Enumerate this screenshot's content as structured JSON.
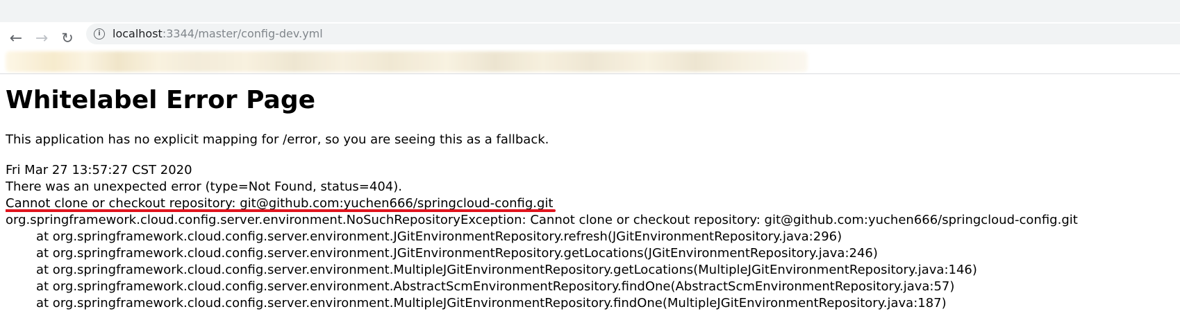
{
  "browser": {
    "url_host": "localhost",
    "url_path": ":3344/master/config-dev.yml",
    "back_icon": "arrow-left-icon",
    "forward_icon": "arrow-right-icon",
    "reload_icon": "reload-icon",
    "info_icon": "info-icon"
  },
  "page": {
    "title": "Whitelabel Error Page",
    "fallback_message": "This application has no explicit mapping for /error, so you are seeing this as a fallback.",
    "timestamp": "Fri Mar 27 13:57:27 CST 2020",
    "error_summary": "There was an unexpected error (type=Not Found, status=404).",
    "error_detail": "Cannot clone or checkout repository: git@github.com:yuchen666/springcloud-config.git",
    "exception": "org.springframework.cloud.config.server.environment.NoSuchRepositoryException: Cannot clone or checkout repository: git@github.com:yuchen666/springcloud-config.git",
    "stack_trace": [
      "at org.springframework.cloud.config.server.environment.JGitEnvironmentRepository.refresh(JGitEnvironmentRepository.java:296)",
      "at org.springframework.cloud.config.server.environment.JGitEnvironmentRepository.getLocations(JGitEnvironmentRepository.java:246)",
      "at org.springframework.cloud.config.server.environment.MultipleJGitEnvironmentRepository.getLocations(MultipleJGitEnvironmentRepository.java:146)",
      "at org.springframework.cloud.config.server.environment.AbstractScmEnvironmentRepository.findOne(AbstractScmEnvironmentRepository.java:57)",
      "at org.springframework.cloud.config.server.environment.MultipleJGitEnvironmentRepository.findOne(MultipleJGitEnvironmentRepository.java:187)"
    ]
  },
  "colors": {
    "underline": "#e0141e",
    "toolbar_icon": "#5f6368",
    "url_path": "#80868b"
  }
}
